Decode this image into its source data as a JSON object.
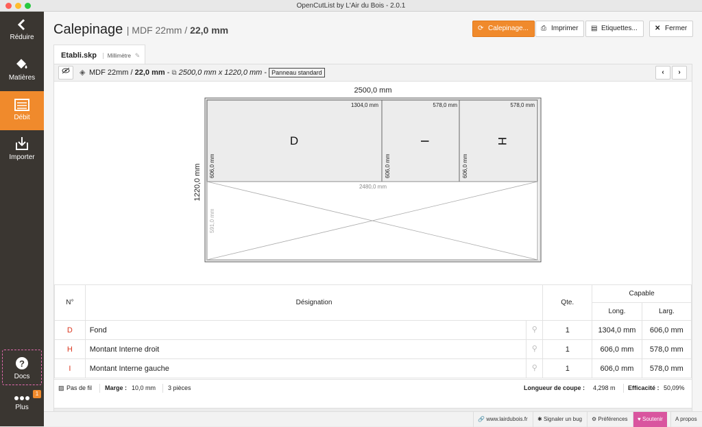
{
  "window": {
    "title": "OpenCutList by L'Air du Bois - 2.0.1"
  },
  "sidebar": {
    "items": [
      {
        "label": "Réduire",
        "icon": "chevron-left-icon"
      },
      {
        "label": "Matières",
        "icon": "paint-bucket-icon"
      },
      {
        "label": "Débit",
        "icon": "list-icon"
      },
      {
        "label": "Importer",
        "icon": "import-icon"
      },
      {
        "label": "Docs",
        "icon": "question-icon"
      },
      {
        "label": "Plus",
        "icon": "dots-icon"
      }
    ],
    "active": "Débit",
    "plus_badge": "1"
  },
  "header": {
    "title": "Calepinage",
    "subtitle_material": "| MDF 22mm /",
    "subtitle_thickness": "22,0 mm"
  },
  "buttons": {
    "calepinage": "Calepinage...",
    "imprimer": "Imprimer",
    "etiquettes": "Etiquettes...",
    "fermer": "Fermer"
  },
  "tab": {
    "file": "Etabli.skp",
    "unit": "Millimètre"
  },
  "toolbar": {
    "material": "MDF 22mm /",
    "thickness": "22,0 mm",
    "sep1": "-",
    "size": "2500,0 mm x 1220,0 mm",
    "sep2": "-",
    "panel_type": "Panneau standard"
  },
  "diagram": {
    "width_label": "2500,0 mm",
    "height_label": "1220,0 mm",
    "pieces": [
      {
        "letter": "D",
        "length": "1304,0 mm",
        "width": "606,0 mm"
      },
      {
        "letter": "I",
        "length": "578,0 mm",
        "width": "606,0 mm"
      },
      {
        "letter": "H",
        "length": "578,0 mm",
        "width": "606,0 mm"
      }
    ],
    "offcut": {
      "length": "2480,0 mm",
      "width": "591,0 mm"
    }
  },
  "table": {
    "headers": {
      "num": "N°",
      "designation": "Désignation",
      "qty": "Qte.",
      "capable": "Capable",
      "long": "Long.",
      "larg": "Larg."
    },
    "rows": [
      {
        "num": "D",
        "designation": "Fond",
        "qty": "1",
        "long": "1304,0 mm",
        "larg": "606,0 mm"
      },
      {
        "num": "H",
        "designation": "Montant Interne droit",
        "qty": "1",
        "long": "606,0 mm",
        "larg": "578,0 mm"
      },
      {
        "num": "I",
        "designation": "Montant Interne gauche",
        "qty": "1",
        "long": "606,0 mm",
        "larg": "578,0 mm"
      }
    ]
  },
  "footer": {
    "grain": "Pas de fil",
    "marge_label": "Marge :",
    "marge_value": "10,0 mm",
    "pieces": "3 pièces",
    "coupe_label": "Longueur de coupe :",
    "coupe_value": "4,298 m",
    "efficacite_label": "Efficacité :",
    "efficacite_value": "50,09%"
  },
  "statusbar": {
    "site": "www.lairdubois.fr",
    "bug": "Signaler un bug",
    "prefs": "Préférences",
    "soutenir": "Soutenir",
    "apropos": "A propos"
  },
  "colors": {
    "accent": "#f08a2c",
    "sidebar": "#3a3631",
    "piece_fill": "#ececec",
    "row_letter": "#d9341c",
    "soutenir": "#d9559f"
  }
}
